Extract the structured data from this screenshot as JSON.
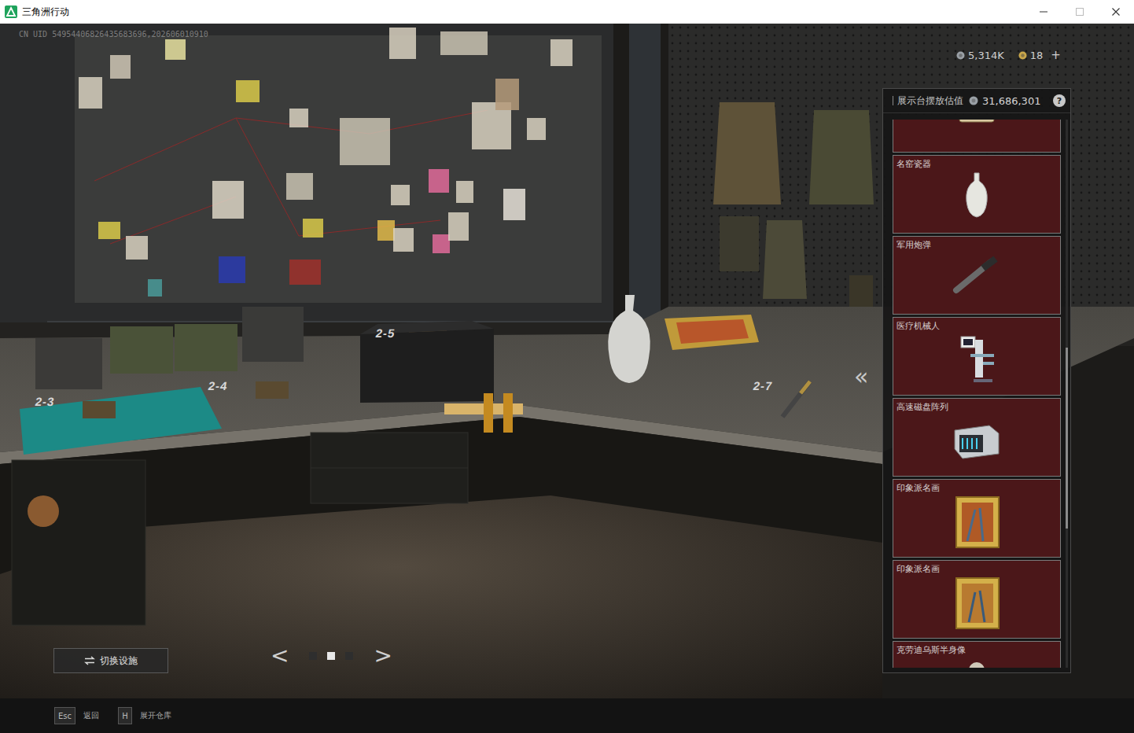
{
  "window": {
    "title": "三角洲行动"
  },
  "watermark": "CN UID 54954406826435683696,202606010910",
  "currencies": [
    {
      "amount": "5,314K",
      "kind": "silver"
    },
    {
      "amount": "18",
      "kind": "gold"
    }
  ],
  "add_currency": "+",
  "scene_labels": [
    "2-3",
    "2-4",
    "2-5",
    "2-7"
  ],
  "collapse_button": "«",
  "display_panel": {
    "title": "展示台摆放估值",
    "value": "31,686,301",
    "help": "?",
    "items": [
      {
        "kind": "cut-top"
      },
      {
        "name": "名窑瓷器",
        "kind": "full"
      },
      {
        "name": "军用炮弹",
        "kind": "full"
      },
      {
        "name": "医疗机械人",
        "kind": "full"
      },
      {
        "name": "高速磁盘阵列",
        "kind": "full"
      },
      {
        "name": "印象派名画",
        "kind": "full"
      },
      {
        "name": "印象派名画",
        "kind": "full"
      },
      {
        "name": "克劳迪乌斯半身像",
        "kind": "cut-bottom"
      }
    ],
    "scrollbar": {
      "level": 0.62
    }
  },
  "switch_button": "切换设施",
  "pager": {
    "prev": "<",
    "next": ">",
    "pages": [
      {
        "selected": false
      },
      {
        "selected": true
      },
      {
        "selected": false
      }
    ]
  },
  "footer": [
    {
      "key": "Esc",
      "label": "返回"
    },
    {
      "key": "H",
      "label": "展开仓库"
    }
  ]
}
